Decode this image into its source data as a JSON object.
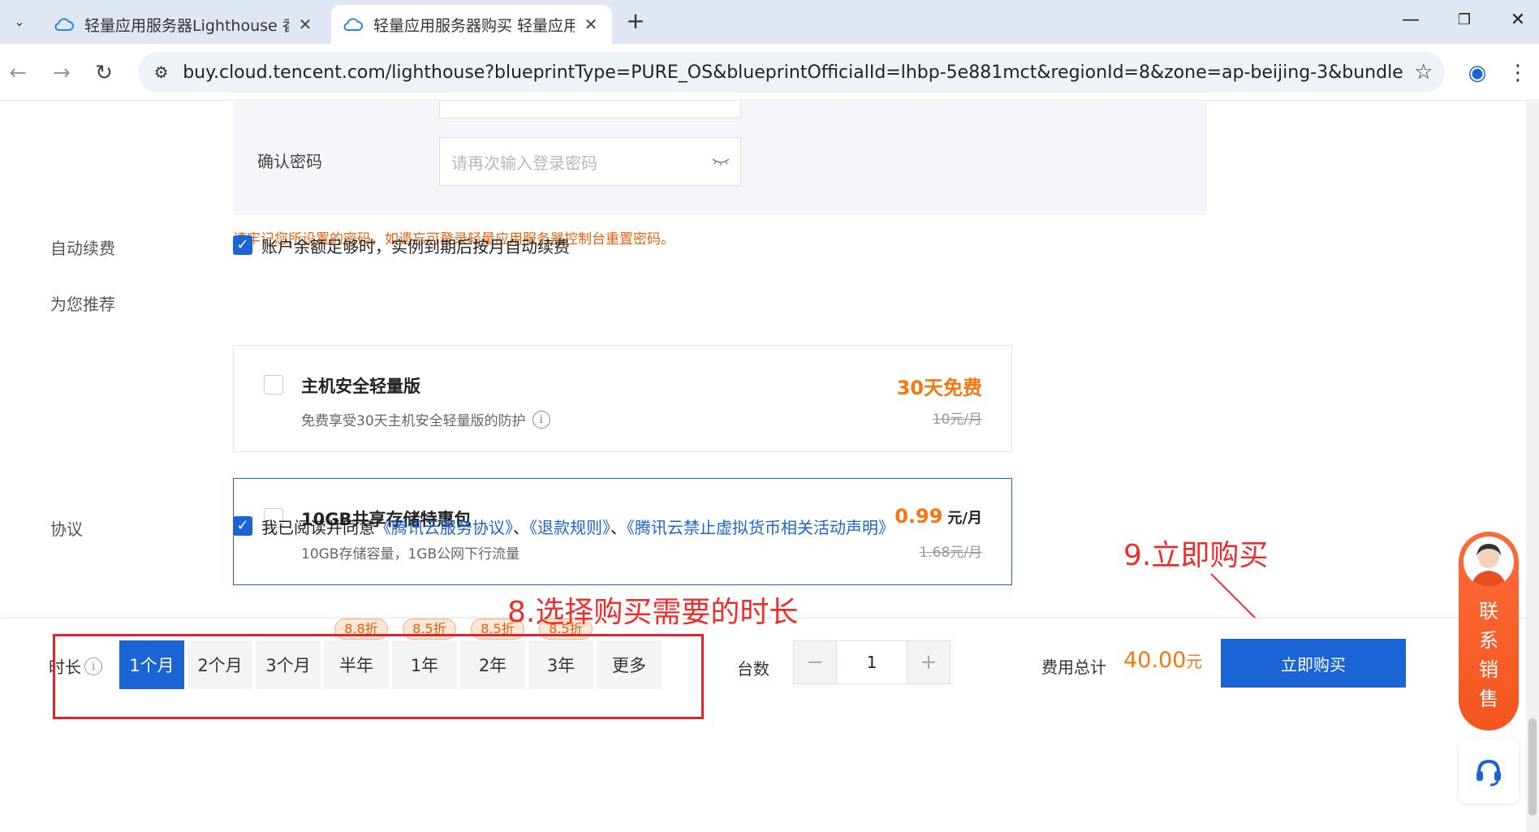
{
  "browser": {
    "tabs": [
      {
        "title": "轻量应用服务器Lighthouse 香",
        "active": false
      },
      {
        "title": "轻量应用服务器购买 轻量应用",
        "active": true
      }
    ],
    "url": "buy.cloud.tencent.com/lighthouse?blueprintType=PURE_OS&blueprintOfficialId=lhbp-5e881mct&regionId=8&zone=ap-beijing-3&bundleId=bun..."
  },
  "password": {
    "confirm_label": "确认密码",
    "confirm_placeholder": "请再次输入登录密码",
    "hint": "请牢记您所设置的密码，如遗忘可登录轻量应用服务器控制台重置密码。"
  },
  "auto_renew": {
    "label": "自动续费",
    "text": "账户余额足够时，实例到期后按月自动续费"
  },
  "recommend": {
    "label": "为您推荐",
    "cards": [
      {
        "title": "主机安全轻量版",
        "desc": "免费享受30天主机安全轻量版的防护",
        "price": "30天免费",
        "price_unit": "",
        "original": "10元/月"
      },
      {
        "title": "10GB共享存储特惠包",
        "desc": "10GB存储容量，1GB公网下行流量",
        "price": "0.99",
        "price_unit": "元/月",
        "original": "1.68元/月"
      }
    ]
  },
  "agreement": {
    "label": "协议",
    "prefix": "我已阅读并同意",
    "link1": "《腾讯云服务协议》",
    "sep1": "、",
    "link2": "《退款规则》",
    "sep2": "、",
    "link3": "《腾讯云禁止虚拟货币相关活动声明》"
  },
  "annotations": {
    "step8": "8.选择购买需要的时长",
    "step9": "9.立即购买"
  },
  "order": {
    "duration_label": "时长",
    "durations": [
      {
        "label": "1个月",
        "badge": ""
      },
      {
        "label": "2个月",
        "badge": ""
      },
      {
        "label": "3个月",
        "badge": ""
      },
      {
        "label": "半年",
        "badge": "8.8折"
      },
      {
        "label": "1年",
        "badge": "8.5折"
      },
      {
        "label": "2年",
        "badge": "8.5折"
      },
      {
        "label": "3年",
        "badge": "8.5折"
      },
      {
        "label": "更多",
        "badge": ""
      }
    ],
    "quantity_label": "台数",
    "quantity": "1",
    "minus": "−",
    "plus": "+",
    "total_label": "费用总计",
    "total_amount": "40.00",
    "total_unit": "元",
    "buy_label": "立即购买"
  },
  "sales": {
    "text": [
      "联",
      "系",
      "销",
      "售"
    ]
  },
  "colors": {
    "primary": "#1a64d6",
    "accent": "#f5770f",
    "annotation": "#ef2d2d"
  }
}
